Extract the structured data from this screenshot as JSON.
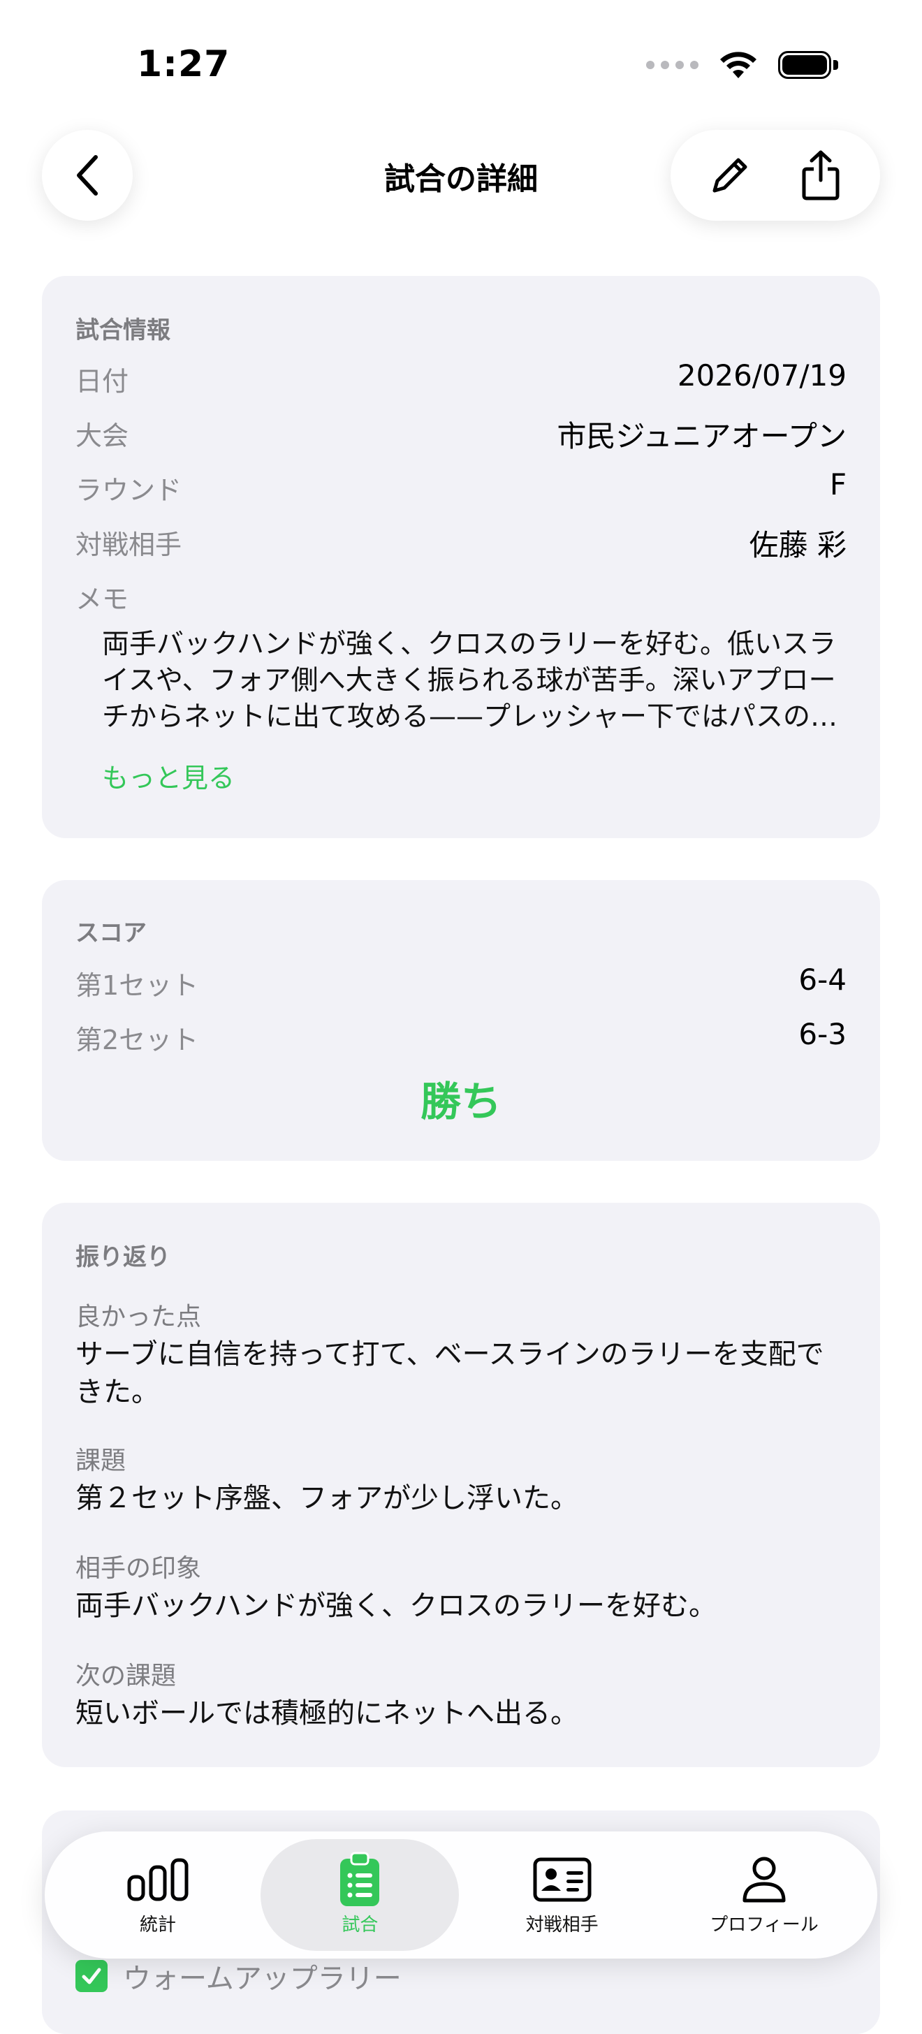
{
  "status_bar": {
    "time": "1:27"
  },
  "nav": {
    "title": "試合の詳細",
    "back_icon": "chevron-left-icon",
    "edit_icon": "pencil-icon",
    "share_icon": "share-icon"
  },
  "match_info": {
    "header": "試合情報",
    "date_label": "日付",
    "date_value": "2026/07/19",
    "tournament_label": "大会",
    "tournament_value": "市民ジュニアオープン",
    "round_label": "ラウンド",
    "round_value": "F",
    "opponent_label": "対戦相手",
    "opponent_value": "佐藤 彩",
    "memo_label": "メモ",
    "memo_text": "両手バックハンドが強く、クロスのラリーを好む。低いスライスや、フォア側へ大きく振られる球が苦手。深いアプローチからネットに出て攻める——プレッシャー下ではパスの…",
    "more_link": "もっと見る"
  },
  "score": {
    "header": "スコア",
    "set1_label": "第1セット",
    "set1_value": "6-4",
    "set2_label": "第2セット",
    "set2_value": "6-3",
    "result": "勝ち"
  },
  "reflection": {
    "header": "振り返り",
    "good_label": "良かった点",
    "good_text": "サーブに自信を持って打て、ベースラインのラリーを支配できた。",
    "issue_label": "課題",
    "issue_text": "第２セット序盤、フォアが少し浮いた。",
    "impression_label": "相手の印象",
    "impression_text": "両手バックハンドが強く、クロスのラリーを好む。",
    "next_label": "次の課題",
    "next_text": "短いボールでは積極的にネットへ出る。"
  },
  "checklist_partial": {
    "item_text": "ウォームアップラリー"
  },
  "tabs": [
    {
      "label": "統計",
      "icon": "bar-chart-icon",
      "active": false
    },
    {
      "label": "試合",
      "icon": "clipboard-list-icon",
      "active": true
    },
    {
      "label": "対戦相手",
      "icon": "id-card-icon",
      "active": false
    },
    {
      "label": "プロフィール",
      "icon": "person-icon",
      "active": false
    }
  ],
  "colors": {
    "accent": "#34c759",
    "card_bg": "#f2f2f7",
    "secondary_text": "#8a8a8e"
  }
}
